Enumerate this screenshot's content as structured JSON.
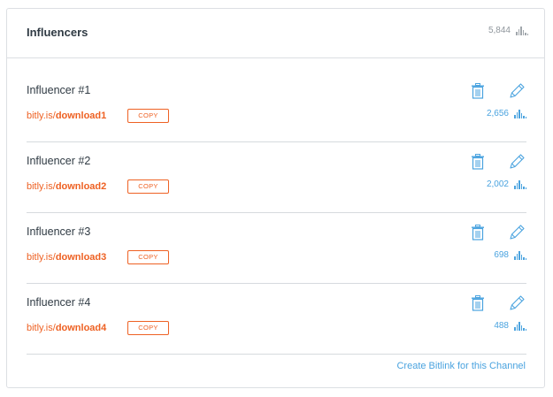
{
  "panel": {
    "title": "Influencers",
    "total_clicks": "5,844",
    "total_icon": "bar-chart-icon"
  },
  "rows": [
    {
      "name": "Influencer #1",
      "link_prefix": "bitly.is/",
      "link_slug": "download1",
      "copy_label": "COPY",
      "clicks": "2,656"
    },
    {
      "name": "Influencer #2",
      "link_prefix": "bitly.is/",
      "link_slug": "download2",
      "copy_label": "COPY",
      "clicks": "2,002"
    },
    {
      "name": "Influencer #3",
      "link_prefix": "bitly.is/",
      "link_slug": "download3",
      "copy_label": "COPY",
      "clicks": "698"
    },
    {
      "name": "Influencer #4",
      "link_prefix": "bitly.is/",
      "link_slug": "download4",
      "copy_label": "COPY",
      "clicks": "488"
    }
  ],
  "footer": {
    "create_label": "Create Bitlink for this Channel"
  },
  "icons": {
    "delete": "trash-icon",
    "edit": "pencil-icon",
    "stats": "bar-chart-icon"
  },
  "colors": {
    "link_orange": "#ee6123",
    "accent_blue": "#4aa3df",
    "muted_gray": "#8f969c"
  }
}
